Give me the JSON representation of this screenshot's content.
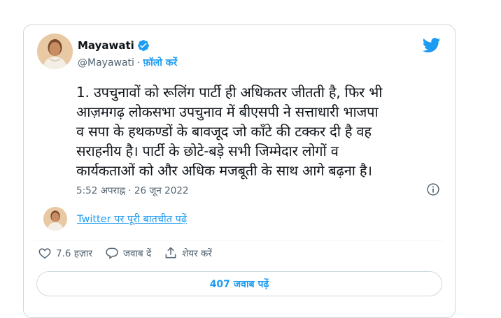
{
  "author": {
    "name": "Mayawati",
    "handle": "@Mayawati",
    "follow_label": "फ़ॉलो करें"
  },
  "tweet": {
    "lines": [
      "1. उपचुनावों को रूलिंग पार्टी ही अधिकतर जीतती है, फिर भी",
      "आज़मगढ़ लोकसभा उपचुनाव में बीएसपी ने सत्ताधारी भाजपा",
      "व सपा के हथकण्डों के बावजूद जो काँटे की टक्कर दी है वह",
      "सराहनीय है। पार्टी के छोटे-बड़े सभी जिम्मेदार लोगों व",
      "कार्यकताओं को और अधिक मजबूती के साथ आगे बढ़ना है।"
    ],
    "timestamp": "5:52 अपराह्न · 26 जून 2022"
  },
  "thread_link": "Twitter पर पूरी बातचीत पढ़ें",
  "actions": {
    "like_count": "7.6 हज़ार",
    "reply_label": "जवाब दें",
    "share_label": "शेयर करें"
  },
  "replies_button": "407 जवाब पढ़ें",
  "colors": {
    "accent": "#1d9bf0",
    "text": "#0f1419",
    "secondary": "#536471",
    "border": "#cfd9de"
  },
  "icons": [
    "verified-badge-icon",
    "twitter-bird-icon",
    "info-icon",
    "heart-icon",
    "reply-icon",
    "share-icon"
  ]
}
